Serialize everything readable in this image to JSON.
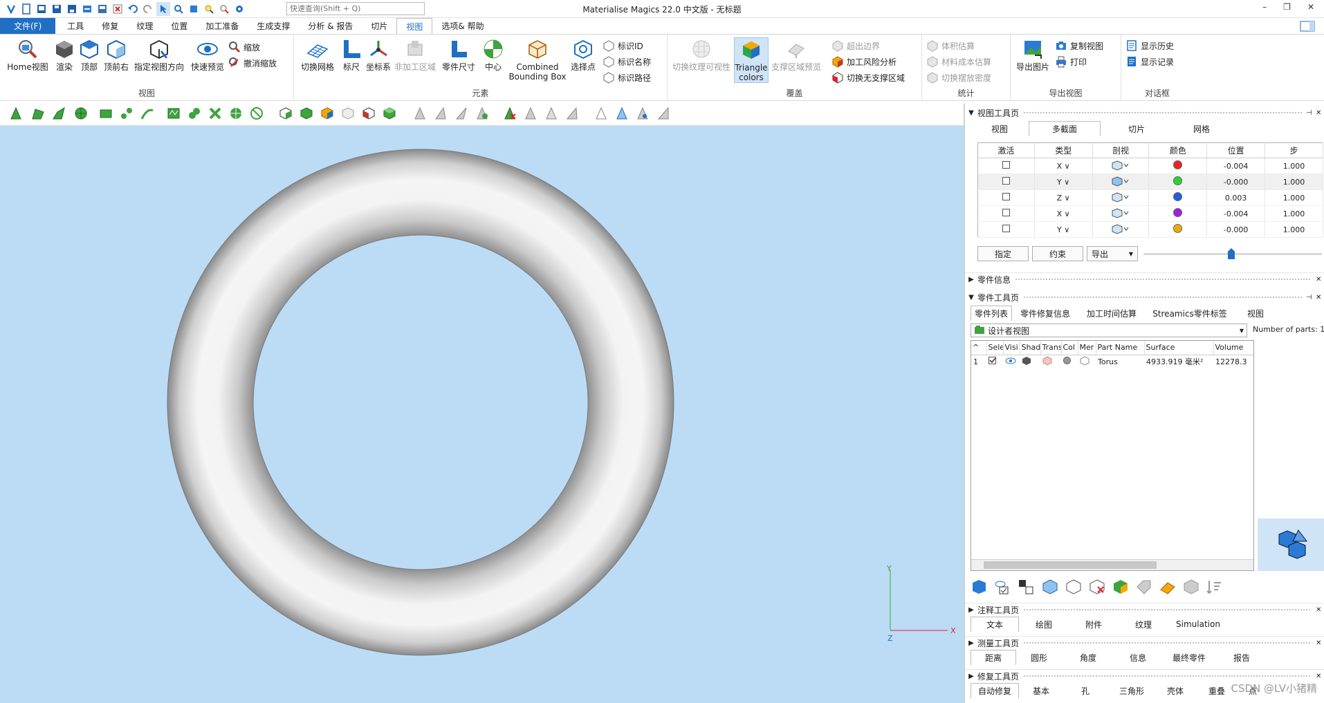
{
  "app": {
    "title": "Materialise Magics 22.0 中文版 - 无标题",
    "search_placeholder": "快速查询(Shift + Q)",
    "window_controls": [
      "–",
      "❐",
      "✕"
    ]
  },
  "menubar": {
    "items": [
      {
        "label": "文件(F)",
        "kind": "file"
      },
      {
        "label": "工具"
      },
      {
        "label": "修复"
      },
      {
        "label": "纹理"
      },
      {
        "label": "位置"
      },
      {
        "label": "加工准备"
      },
      {
        "label": "生成支撑"
      },
      {
        "label": "分析 & 报告"
      },
      {
        "label": "切片"
      },
      {
        "label": "视图",
        "active": true
      },
      {
        "label": "选项& 帮助"
      }
    ]
  },
  "ribbon": {
    "groups": {
      "view": "视图",
      "elements": "元素",
      "overlay": "覆盖",
      "stats": "统计",
      "export": "导出视图",
      "dialog": "对话框"
    },
    "view_buttons": [
      "Home视图",
      "渲染",
      "顶部",
      "顶前右",
      "指定视图方向",
      "快速预览"
    ],
    "zoom": [
      "缩放",
      "撤消缩放"
    ],
    "element_buttons": [
      "切换网格",
      "标尺",
      "坐标系",
      "非加工区域",
      "零件尺寸",
      "中心",
      "Combined Bounding Box",
      "选择点"
    ],
    "label_items": [
      "标识ID",
      "标识名称",
      "标识路径"
    ],
    "overlay_buttons": [
      "切换纹理可视性",
      "Triangle colors",
      "支撑区域预览"
    ],
    "overlay_items": [
      "超出边界",
      "加工风险分析",
      "切换无支撑区域"
    ],
    "stats_items": [
      "体积估算",
      "材料成本估算",
      "切换摆放密度"
    ],
    "export_button": "导出图片",
    "export_items": [
      "复制视图",
      "打印"
    ],
    "dialog_items": [
      "显示历史",
      "显示记录"
    ]
  },
  "axes": {
    "y": "Y",
    "z": "Z",
    "x": "X"
  },
  "view_panel": {
    "title": "视图工具页",
    "tabs": [
      "视图",
      "多截面",
      "切片",
      "网格"
    ],
    "active_tab": 1,
    "columns": [
      "激活",
      "类型",
      "剖视",
      "颜色",
      "位置",
      "步"
    ],
    "rows": [
      {
        "type": "X",
        "color": "#e8202a",
        "position": "-0.004",
        "step": "1.000"
      },
      {
        "type": "Y",
        "color": "#2fd12f",
        "position": "-0.000",
        "step": "1.000"
      },
      {
        "type": "Z",
        "color": "#1f5fe0",
        "position": "0.003",
        "step": "1.000"
      },
      {
        "type": "X",
        "color": "#a020e0",
        "position": "-0.004",
        "step": "1.000"
      },
      {
        "type": "Y",
        "color": "#f5a800",
        "position": "-0.000",
        "step": "1.000"
      }
    ],
    "buttons": {
      "assign": "指定",
      "constraint": "约束",
      "export": "导出"
    }
  },
  "part_info": {
    "title": "零件信息"
  },
  "part_panel": {
    "title": "零件工具页",
    "tabs": [
      "零件列表",
      "零件修复信息",
      "加工时间估算",
      "Streamics零件标签",
      "视图"
    ],
    "view_select": "设计者视图",
    "num_parts_label": "Number of parts: 1",
    "columns": [
      "",
      "Sele",
      "Visi",
      "Shad",
      "Trans",
      "Col",
      "Mer",
      "Part Name",
      "Surface",
      "Volume"
    ],
    "rows": [
      {
        "index": "1",
        "name": "Torus",
        "surface": "4933.919 毫米²",
        "volume": "12278.3"
      }
    ]
  },
  "annotation_panel": {
    "title": "注释工具页",
    "tabs": [
      "文本",
      "绘图",
      "附件",
      "纹理",
      "Simulation"
    ]
  },
  "measure_panel": {
    "title": "测量工具页",
    "tabs": [
      "距离",
      "圆形",
      "角度",
      "信息",
      "最终零件",
      "报告"
    ]
  },
  "repair_panel": {
    "title": "修复工具页",
    "tabs": [
      "自动修复",
      "基本",
      "孔",
      "三角形",
      "壳体",
      "重叠",
      "点"
    ]
  },
  "watermark": "CSDN @LV小猪精"
}
